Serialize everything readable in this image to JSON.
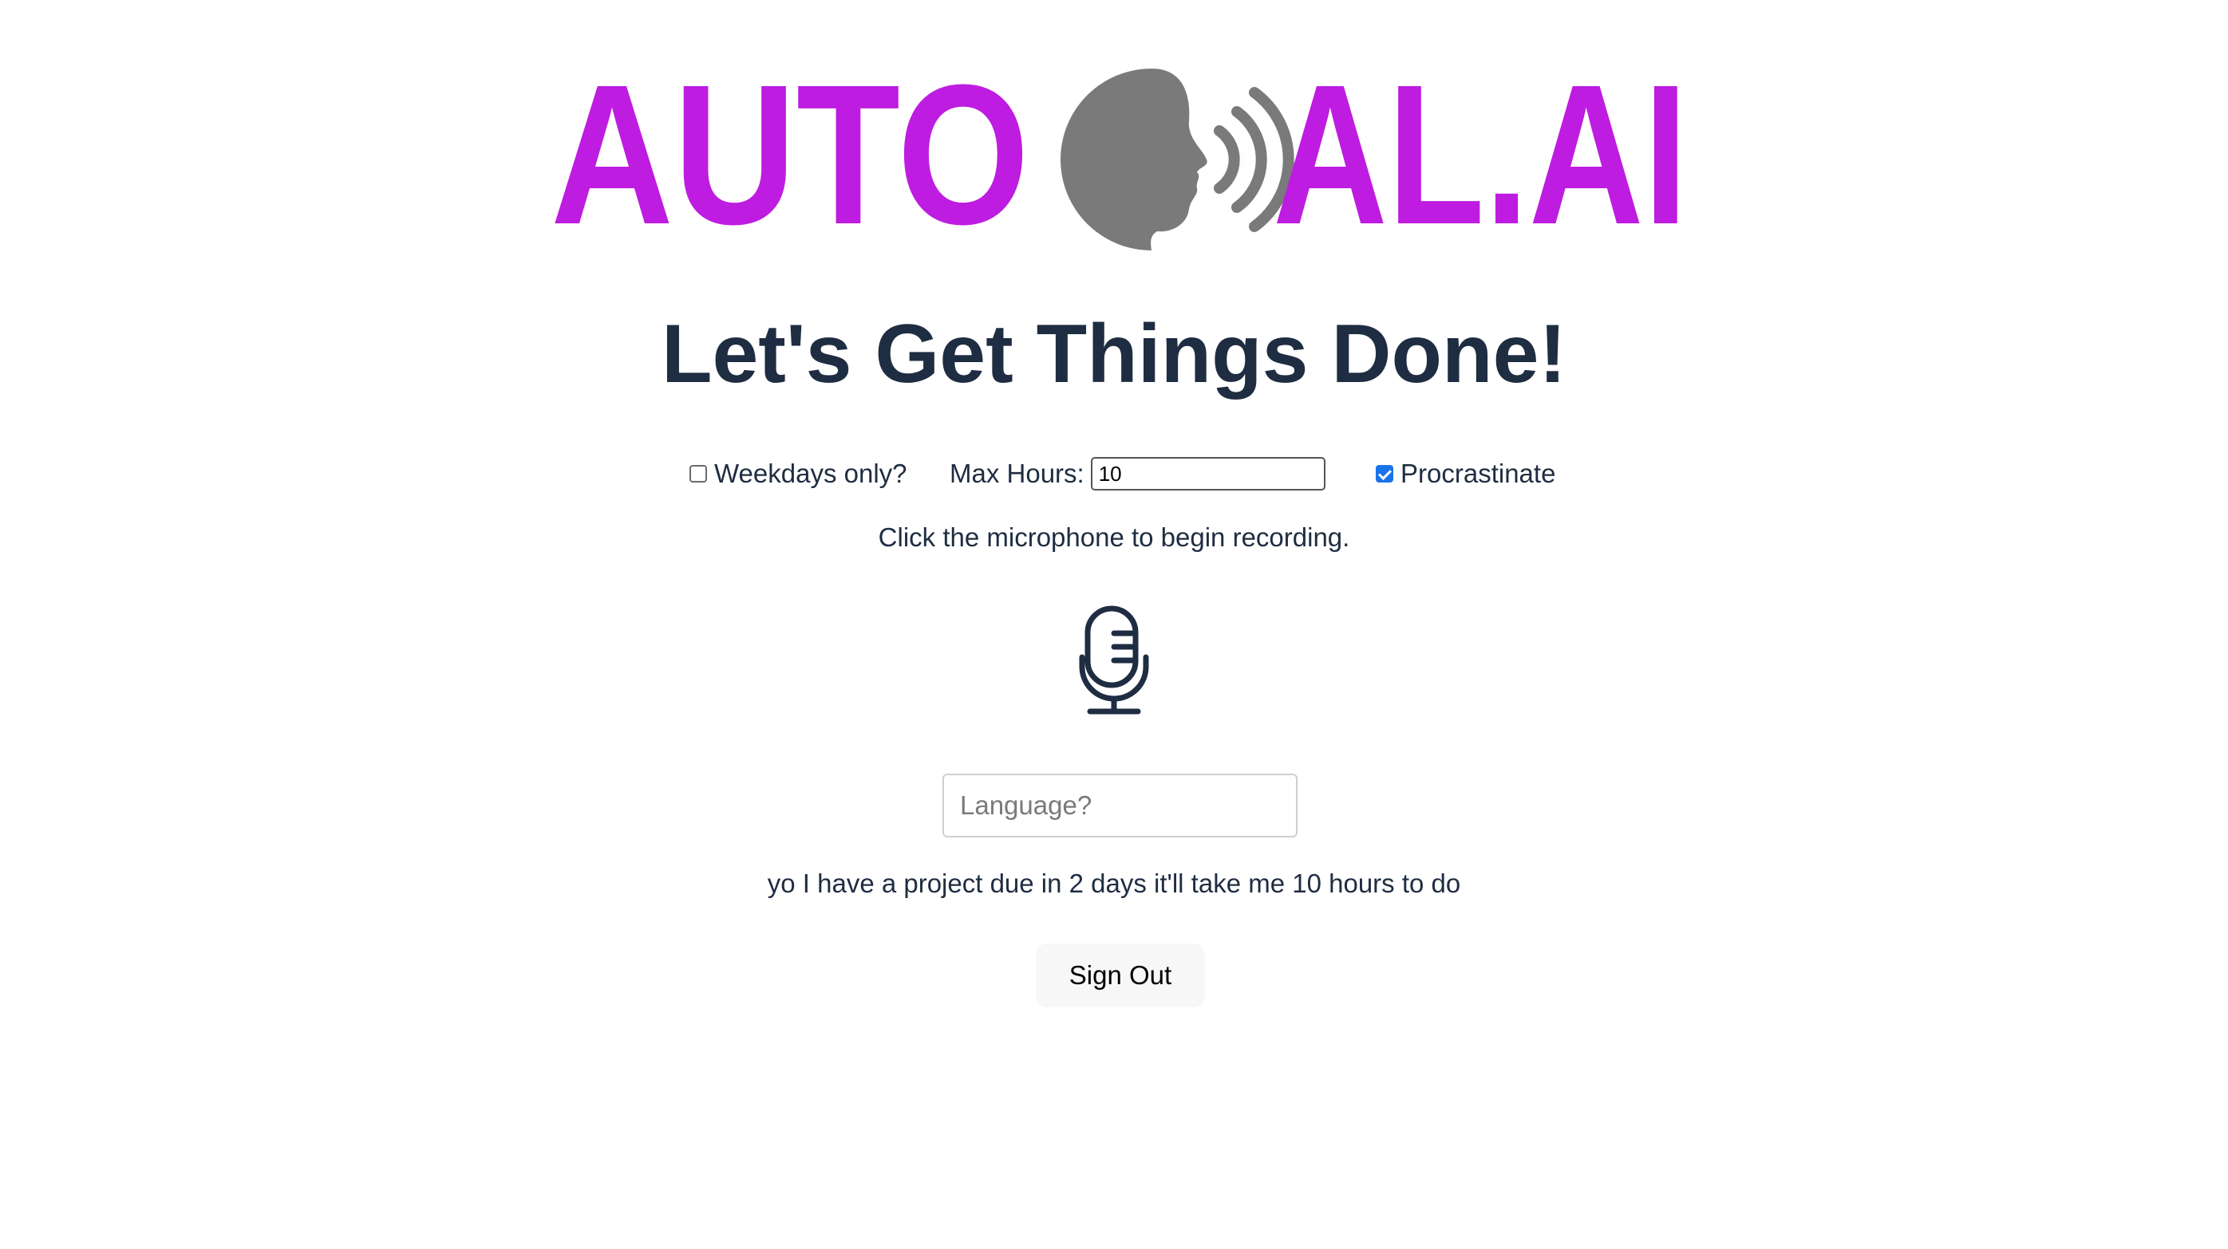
{
  "logo": {
    "text_left": "AUTO",
    "text_right": "AL.AI",
    "brand_color": "#be1ce0",
    "icon_color": "#7a7a7a",
    "icon": "speaking-head-icon"
  },
  "header": {
    "title": "Let's Get Things Done!"
  },
  "options": {
    "weekdays_label": "Weekdays only?",
    "weekdays_checked": false,
    "max_hours_label": "Max Hours:",
    "max_hours_value": "10",
    "procrastinate_label": "Procrastinate",
    "procrastinate_checked": true
  },
  "instructions": "Click the microphone to begin recording.",
  "microphone": {
    "icon": "microphone-icon"
  },
  "language": {
    "placeholder": "Language?",
    "value": ""
  },
  "transcript": "yo I have a project due in 2 days it'll take me 10 hours to do",
  "actions": {
    "sign_out_label": "Sign Out"
  }
}
